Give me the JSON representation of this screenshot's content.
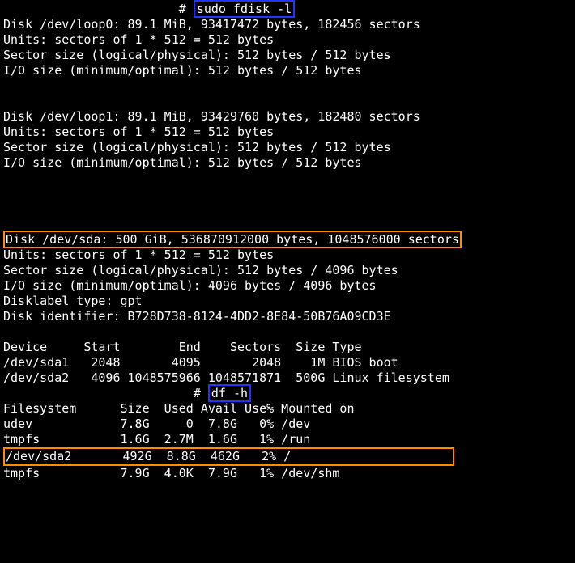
{
  "prompt": "# ",
  "cmd1": "sudo fdisk -l",
  "cmd2": "df -h",
  "loop0": {
    "l1": "Disk /dev/loop0: 89.1 MiB, 93417472 bytes, 182456 sectors",
    "l2": "Units: sectors of 1 * 512 = 512 bytes",
    "l3": "Sector size (logical/physical): 512 bytes / 512 bytes",
    "l4": "I/O size (minimum/optimal): 512 bytes / 512 bytes"
  },
  "loop1": {
    "l1": "Disk /dev/loop1: 89.1 MiB, 93429760 bytes, 182480 sectors",
    "l2": "Units: sectors of 1 * 512 = 512 bytes",
    "l3": "Sector size (logical/physical): 512 bytes / 512 bytes",
    "l4": "I/O size (minimum/optimal): 512 bytes / 512 bytes"
  },
  "sda": {
    "l1": "Disk /dev/sda: 500 GiB, 536870912000 bytes, 1048576000 sectors",
    "l2": "Units: sectors of 1 * 512 = 512 bytes",
    "l3": "Sector size (logical/physical): 512 bytes / 4096 bytes",
    "l4": "I/O size (minimum/optimal): 4096 bytes / 4096 bytes",
    "l5": "Disklabel type: gpt",
    "l6": "Disk identifier: B728D738-8124-4DD2-8E84-50B76A09CD3E"
  },
  "ptable": {
    "hdr": "Device     Start        End    Sectors  Size Type",
    "r1": "/dev/sda1   2048       4095       2048    1M BIOS boot",
    "r2": "/dev/sda2   4096 1048575966 1048571871  500G Linux filesystem"
  },
  "df": {
    "hdr": "Filesystem      Size  Used Avail Use% Mounted on",
    "r1": "udev            7.8G     0  7.8G   0% /dev",
    "r2": "tmpfs           1.6G  2.7M  1.6G   1% /run",
    "r3": "/dev/sda2       492G  8.8G  462G   2% /                      ",
    "r4": "tmpfs           7.9G  4.0K  7.9G   1% /dev/shm"
  },
  "indent_cmd1": "                        ",
  "indent_cmd2": "                          "
}
